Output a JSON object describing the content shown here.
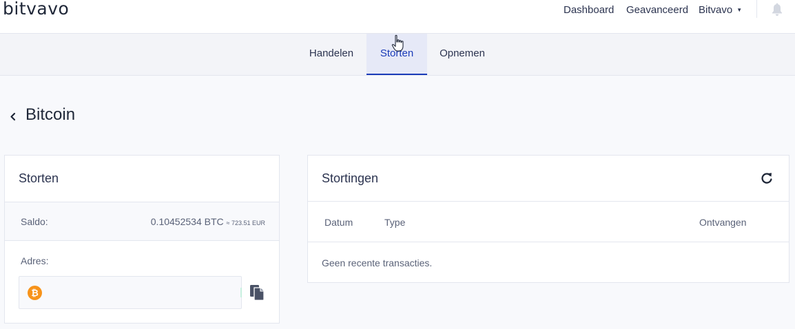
{
  "header": {
    "logo": "bitvavo",
    "nav": [
      "Dashboard",
      "Geavanceerd",
      "Bitvavo"
    ]
  },
  "tabs": [
    "Handelen",
    "Storten",
    "Opnemen"
  ],
  "page": {
    "title": "Bitcoin"
  },
  "deposit": {
    "title": "Storten",
    "balance_label": "Saldo:",
    "balance_btc": "0.10452534 BTC",
    "balance_eur": "≈ 723.51 EUR",
    "address_label": "Adres:",
    "address_value": ""
  },
  "history": {
    "title": "Stortingen",
    "columns": [
      "Datum",
      "Type",
      "Ontvangen"
    ],
    "empty_text": "Geen recente transacties."
  },
  "icons": {
    "coin_symbol": "₿",
    "back": "chevron-left-icon",
    "bell": "bell-icon",
    "copy": "copy-icon",
    "refresh": "refresh-icon",
    "cursor": "hand-cursor-icon"
  },
  "colors": {
    "accent": "#1a3bb8",
    "bitcoin": "#f7931a",
    "active_tab_bg": "#e6e9f7"
  }
}
